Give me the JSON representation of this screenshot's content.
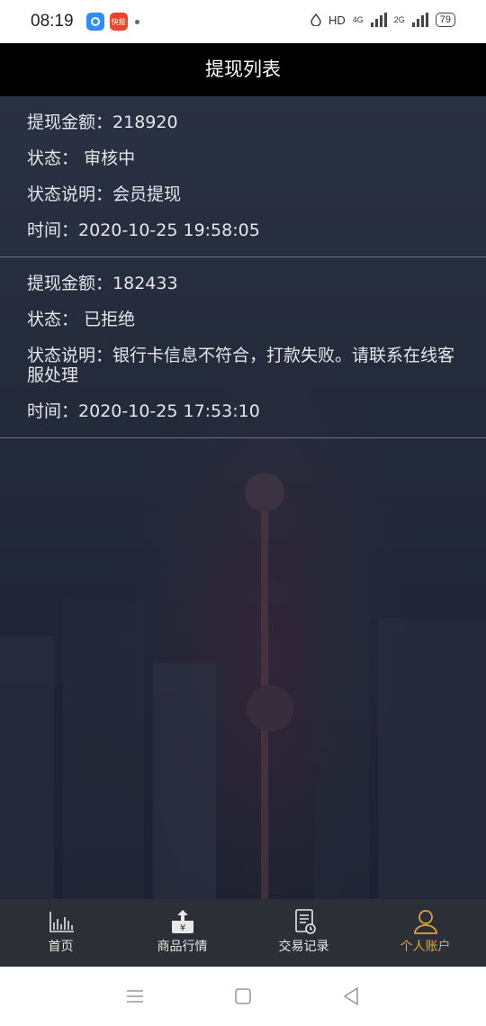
{
  "status_bar": {
    "time": "08:19",
    "app2_label": "快报",
    "network": "HD",
    "net2": "4G",
    "net3": "2G",
    "battery": "79"
  },
  "header": {
    "title": "提现列表"
  },
  "records": [
    {
      "amount_label": "提现金额：",
      "amount": "218920",
      "status_label": "状态：",
      "status": "审核中",
      "desc_label": "状态说明：",
      "desc": "会员提现",
      "time_label": "时间：",
      "time": "2020-10-25 19:58:05"
    },
    {
      "amount_label": "提现金额：",
      "amount": "182433",
      "status_label": "状态：",
      "status": "已拒绝",
      "desc_label": "状态说明：",
      "desc": "银行卡信息不符合，打款失败。请联系在线客服处理",
      "time_label": "时间：",
      "time": "2020-10-25 17:53:10"
    }
  ],
  "tabbar": {
    "items": [
      {
        "label": "首页",
        "icon": "chart-icon"
      },
      {
        "label": "商品行情",
        "icon": "yuan-upload-icon"
      },
      {
        "label": "交易记录",
        "icon": "document-clock-icon"
      },
      {
        "label": "个人账户",
        "icon": "person-icon"
      }
    ],
    "active_color": "#e0a33a"
  },
  "system_nav": {
    "icons": [
      "menu-icon",
      "home-square-icon",
      "back-triangle-icon"
    ]
  }
}
